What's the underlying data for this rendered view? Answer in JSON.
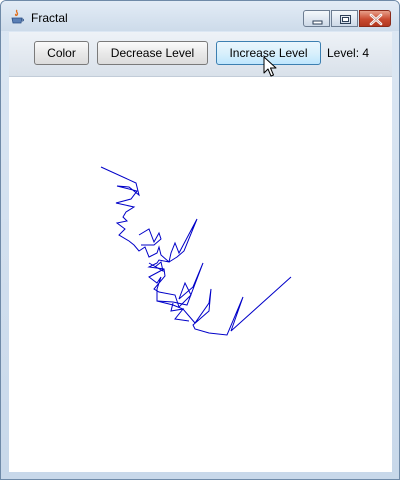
{
  "window": {
    "title": "Fractal",
    "icon": "java-icon",
    "controls": [
      "minimize-icon",
      "maximize-icon",
      "close-icon"
    ]
  },
  "toolbar": {
    "color_label": "Color",
    "decrease_label": "Decrease Level",
    "increase_label": "Increase Level",
    "level_text": "Level: 4"
  },
  "fractal": {
    "level": 4,
    "stroke_color": "#0000c8"
  },
  "colors": {
    "title_bar": "#cddbea",
    "close_button": "#c94a30",
    "hover_button": "#bee6fd",
    "canvas_background": "#ffffff"
  }
}
